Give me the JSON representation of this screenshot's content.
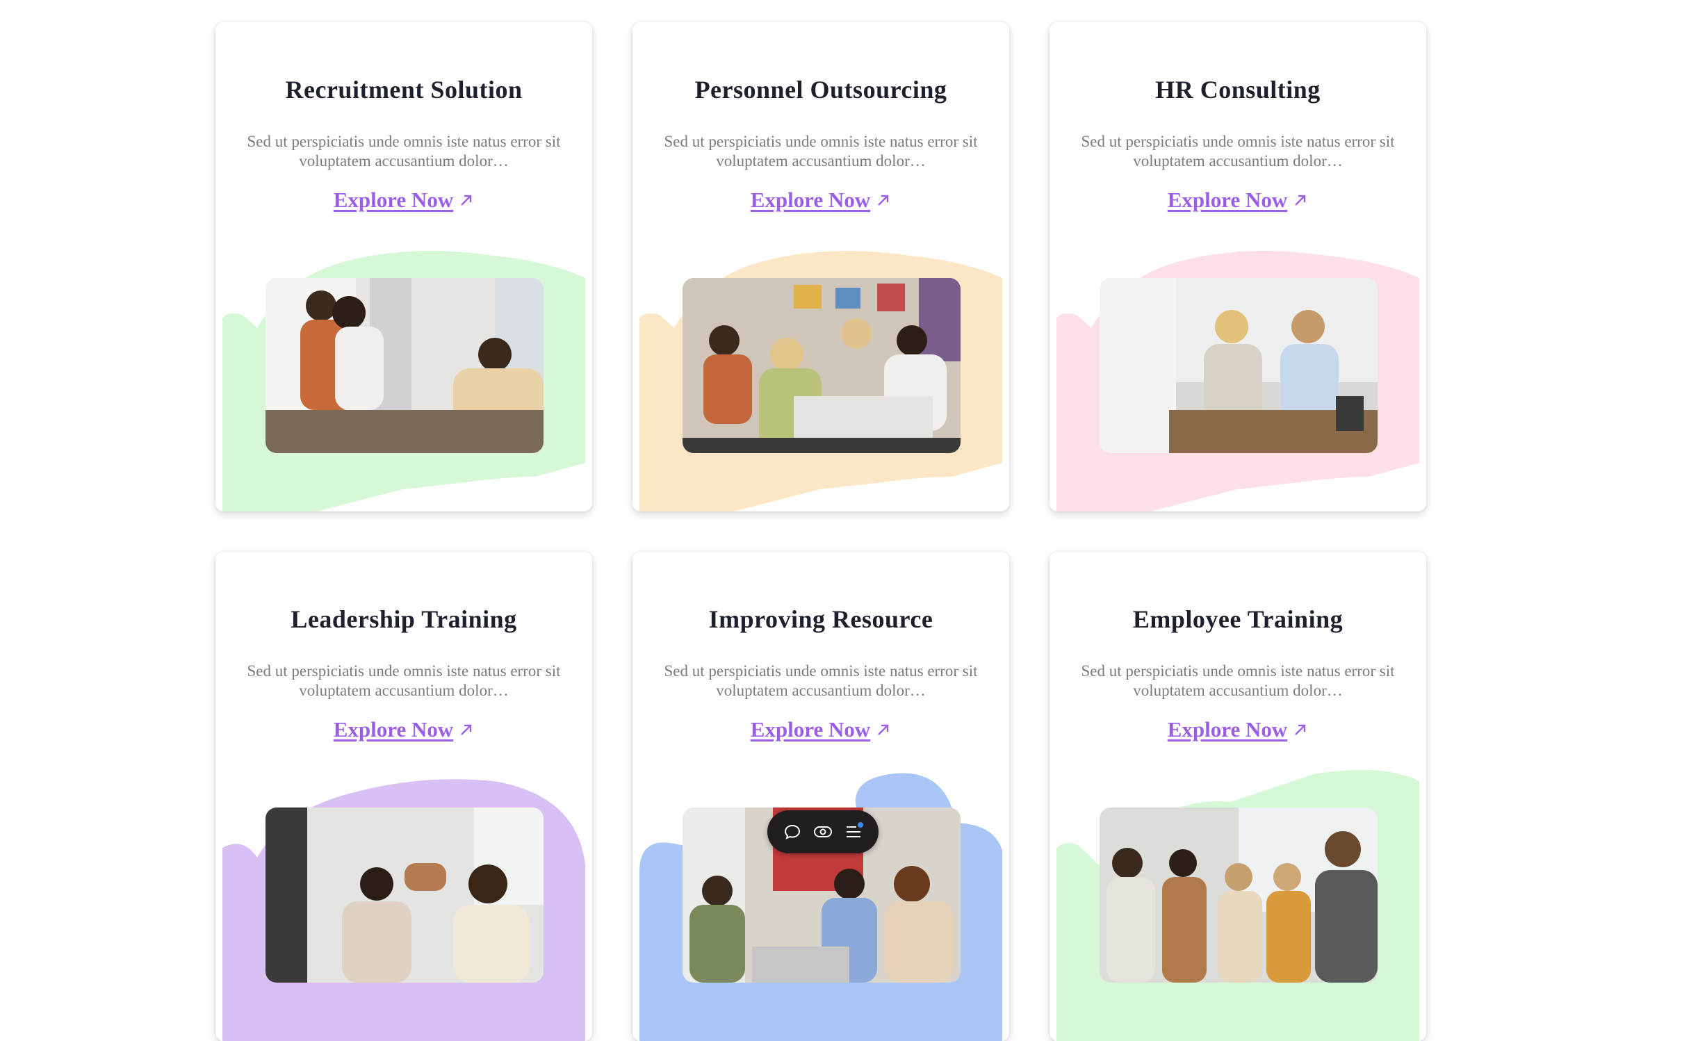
{
  "cards": [
    {
      "title": "Recruitment Solution",
      "text": "Sed ut perspiciatis unde omnis iste natus error sit voluptatem accusantium dolor…",
      "link": "Explore Now",
      "blob_color": "#d6f8d6",
      "image": "team-hug-celebration-photo"
    },
    {
      "title": "Personnel Outsourcing",
      "text": "Sed ut perspiciatis unde omnis iste natus error sit voluptatem accusantium dolor…",
      "link": "Explore Now",
      "blob_color": "#fbe7c6",
      "image": "office-team-applause-photo"
    },
    {
      "title": "HR Consulting",
      "text": "Sed ut perspiciatis unde omnis iste natus error sit voluptatem accusantium dolor…",
      "link": "Explore Now",
      "blob_color": "#fde0e7",
      "image": "business-meeting-women-photo"
    },
    {
      "title": "Leadership Training",
      "text": "Sed ut perspiciatis unde omnis iste natus error sit voluptatem accusantium dolor…",
      "link": "Explore Now",
      "blob_color": "#d8c0f4",
      "image": "high-five-colleagues-photo"
    },
    {
      "title": "Improving Resource",
      "text": "Sed ut perspiciatis unde omnis iste natus error sit voluptatem accusantium dolor…",
      "link": "Explore Now",
      "blob_color": "#a9c6f7",
      "image": "laughing-coworkers-desk-photo"
    },
    {
      "title": "Employee Training",
      "text": "Sed ut perspiciatis unde omnis iste natus error sit voluptatem accusantium dolor…",
      "link": "Explore Now",
      "blob_color": "#d6f8d6",
      "image": "team-clapping-presentation-photo"
    }
  ],
  "toolbar": {
    "icons": [
      "comment-icon",
      "view-icon",
      "menu-list-icon"
    ],
    "dot_color": "#3b8cff"
  }
}
